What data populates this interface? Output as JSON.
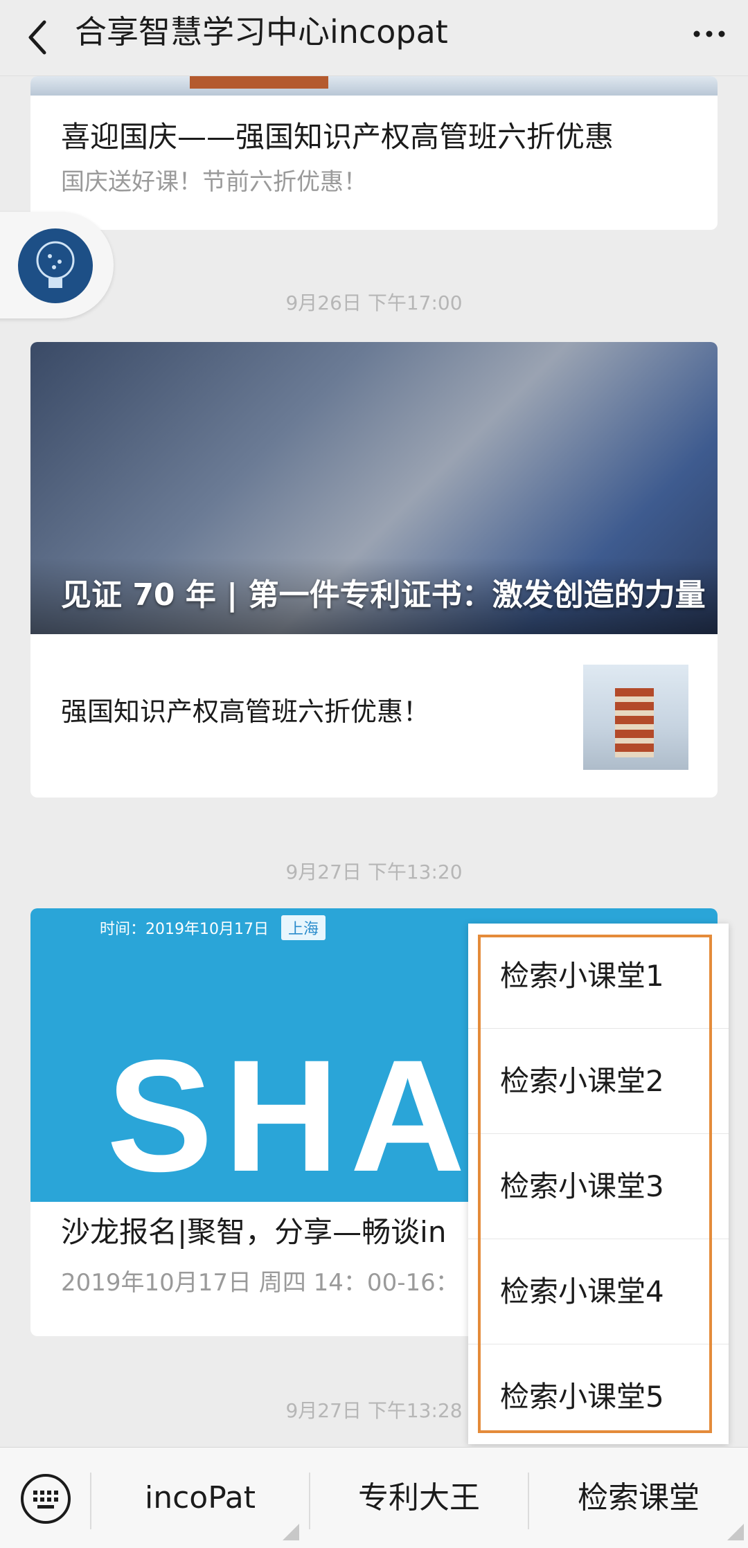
{
  "header": {
    "title": "合享智慧学习中心incopat"
  },
  "feed": {
    "card1": {
      "title": "喜迎国庆——强国知识产权高管班六折优惠",
      "subtitle": "国庆送好课！节前六折优惠！"
    },
    "time1": "9月26日 下午17:00",
    "card2": {
      "caption": "见证 70 年 | 第一件专利证书：激发创造的力量",
      "item_title": "强国知识产权高管班六折优惠！"
    },
    "time2": "9月27日 下午13:20",
    "card3": {
      "banner_date": "时间：2019年10月17日",
      "banner_tag": "上海",
      "banner_word": "SHAR",
      "title": "沙龙报名|聚智，分享—畅谈in",
      "subtitle": "2019年10月17日 周四 14：00-16："
    },
    "time3": "9月27日 下午13:28"
  },
  "popup_menu": {
    "items": [
      "检索小课堂1",
      "检索小课堂2",
      "检索小课堂3",
      "检索小课堂4",
      "检索小课堂5"
    ]
  },
  "bottom_menu": {
    "tabs": [
      "incoPat",
      "专利大王",
      "检索课堂"
    ]
  },
  "colors": {
    "highlight": "#e48b3a",
    "background": "#ececec"
  }
}
